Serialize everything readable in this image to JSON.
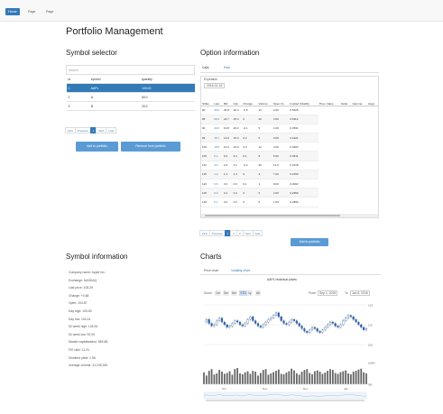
{
  "nav": {
    "items": [
      {
        "label": "Home",
        "active": true
      },
      {
        "label": "Page",
        "active": false
      },
      {
        "label": "Page",
        "active": false
      }
    ]
  },
  "page_title": "Portfolio Management",
  "symbol_selector": {
    "title": "Symbol selector",
    "filter_placeholder": "Search",
    "columns": [
      "id",
      "symbol",
      "quantity"
    ],
    "rows": [
      {
        "id": "1",
        "symbol": "AAPL",
        "quantity": "100.00",
        "selected": true
      },
      {
        "id": "2",
        "symbol": "A",
        "quantity": "50.0",
        "selected": false
      },
      {
        "id": "3",
        "symbol": "B",
        "quantity": "20.0",
        "selected": false
      }
    ],
    "pager": [
      "First",
      "Previous",
      "1",
      "Next",
      "Last"
    ],
    "add_button": "Add to portfolio",
    "remove_button": "Remove from portfolio"
  },
  "option_information": {
    "title": "Option information",
    "tabs": [
      "Calls",
      "Puts"
    ],
    "date_select": "Expiration",
    "date_value": "2016-01-15",
    "columns": [
      "Strike",
      "Last",
      "Bid",
      "Ask",
      "Change",
      "Volume",
      "Open Int",
      "Implied Volatility",
      "Theo. Value",
      "Delta",
      "Gamma",
      "Vega"
    ],
    "rows": [
      [
        "80",
        "30.0",
        "29.8",
        "30.4",
        "-0.5",
        "10",
        "2.00",
        "0.5625"
      ],
      [
        "85",
        "25.0",
        "24.7",
        "25.3",
        "0",
        "20",
        "3.00",
        "0.5112"
      ],
      [
        "90",
        "20.0",
        "19.8",
        "20.2",
        "-0.1",
        "5",
        "1.00",
        "0.4531"
      ],
      [
        "95",
        "15.1",
        "14.9",
        "15.3",
        "0.2",
        "0",
        "0.00",
        "0.4221"
      ],
      [
        "100",
        "10.5",
        "10.3",
        "10.6",
        "0.3",
        "12",
        "4.00",
        "0.3924"
      ],
      [
        "105",
        "6.1",
        "6.0",
        "6.2",
        "0.1",
        "8",
        "5.00",
        "0.3611"
      ],
      [
        "110",
        "3.0",
        "2.9",
        "3.1",
        "-0.2",
        "30",
        "12.0",
        "0.3378"
      ],
      [
        "115",
        "1.2",
        "1.1",
        "1.3",
        "0",
        "3",
        "7.00",
        "0.3150"
      ],
      [
        "120",
        "0.5",
        "0.4",
        "0.6",
        "0.1",
        "1",
        "9.00",
        "0.3002"
      ],
      [
        "125",
        "0.2",
        "0.1",
        "0.3",
        "0",
        "0",
        "2.00",
        "0.2950"
      ],
      [
        "130",
        "0.1",
        "0.0",
        "0.2",
        "0",
        "0",
        "1.00",
        "0.2890"
      ]
    ],
    "pager": [
      "First",
      "Previous",
      "1",
      "2",
      "3",
      "Next",
      "Last"
    ],
    "add_button": "Add to portfolio"
  },
  "symbol_information": {
    "title": "Symbol information",
    "items": [
      "Company name: Apple Inc.",
      "Exchange: NASDAQ",
      "Last price: 105.26",
      "Change: +0.68",
      "Open: 104.87",
      "Day high: 105.83",
      "Day low: 104.24",
      "52 week high: 134.54",
      "52 week low: 92.00",
      "Market capitalization: 583.6B",
      "P/E ratio: 11.91",
      "Dividend yield: 1.98",
      "Average volume: 41,245,300"
    ]
  },
  "charts": {
    "title": "Charts",
    "tabs": [
      "Price chart",
      "Volatility chart"
    ],
    "chart_title": "AAPL historical prices",
    "zoom_label": "Zoom",
    "zoom_buttons": [
      "1m",
      "3m",
      "6m",
      "YTD",
      "1y",
      "All"
    ],
    "from_label": "From",
    "from_value": "Sep 1, 2015",
    "to_label": "To",
    "to_value": "Jan 5, 2016",
    "price_axis": [
      "120",
      "110",
      "100"
    ],
    "volume_axis": [
      "100M",
      "0M"
    ],
    "x_axis": [
      "Oct",
      "Nov",
      "Dec",
      "Jan"
    ]
  },
  "chart_data": {
    "type": "line",
    "title": "AAPL historical prices",
    "xlabel": "",
    "ylabel": "",
    "ylim": [
      95,
      125
    ],
    "series": [
      {
        "values": [
          112,
          114,
          111,
          109,
          110,
          113,
          115,
          112,
          110,
          108,
          109,
          111,
          113,
          112,
          110,
          109,
          111,
          114,
          116,
          113,
          111,
          109,
          108,
          110,
          112,
          114,
          115,
          117,
          119,
          116,
          113,
          111,
          110,
          112,
          114,
          113,
          111,
          109,
          107,
          105,
          104,
          106,
          108,
          107,
          105,
          104,
          106,
          108,
          110,
          112,
          111,
          109,
          108,
          110,
          113,
          115,
          117,
          116,
          114,
          112,
          110,
          108,
          106,
          107
        ]
      }
    ],
    "volume": [
      55,
      40,
      62,
      70,
      45,
      50,
      66,
      58,
      48,
      52,
      60,
      44,
      70,
      75,
      50,
      46,
      55,
      60,
      48,
      62,
      58,
      40,
      52,
      66,
      70,
      44,
      50,
      56,
      62,
      68,
      48,
      46,
      54,
      60,
      72,
      64,
      50,
      44,
      58,
      66,
      70,
      52,
      46,
      60,
      64,
      58,
      48,
      54,
      62,
      70,
      66,
      52,
      48,
      56,
      60,
      64,
      50,
      46,
      58,
      62,
      68,
      72,
      55,
      50
    ],
    "grid": true
  }
}
